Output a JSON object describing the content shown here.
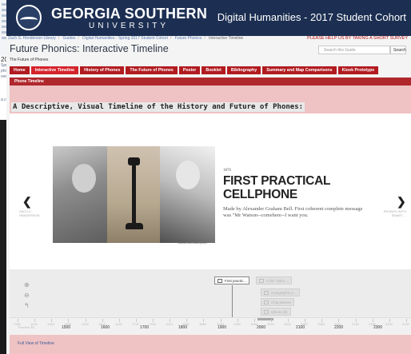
{
  "background_page": {
    "items": [
      "2017",
      "Spring",
      "phonics",
      "over",
      "a contr"
    ]
  },
  "header": {
    "university_name": "GEORGIA SOUTHERN",
    "university_sub": "UNIVERSITY",
    "site_title": "Digital Humanities - 2017 Student Cohort"
  },
  "breadcrumbs": [
    "Zach S. Henderson Library",
    "Guides",
    "Digital Humanities - Spring 2017 Student Cohort",
    "Future Phonics",
    "Interactive Timeline"
  ],
  "help_link": "PLEASE HELP US BY TAKING A SHORT SURVEY",
  "guide": {
    "title": "Future Phonics: Interactive Timeline",
    "owner": "The Future of Phones"
  },
  "search": {
    "placeholder": "Search this Guide",
    "button": "Search"
  },
  "tabs": [
    "Home",
    "Interactive Timeline",
    "History of Phones",
    "The Future of Phones",
    "Poster",
    "Booklet",
    "Bibliography",
    "Summary and Map Comparisons",
    "Kiosk Prototype"
  ],
  "active_tab": "Interactive Timeline",
  "section_title": "Phone Timeline",
  "timeline_heading": "A Descriptive, Visual Timeline of the History and Future of Phones:",
  "slide": {
    "credit": "Savannah.Bailey440",
    "year": "1876",
    "title": "FIRST PRACTICAL CELLPHONE",
    "text": "Made by Alexander Graham Bell. First coherent complete message was \"Mr Watson--comehere--I want you.",
    "prev_label": "ZACH S. HENDERSON",
    "next_label": "PHONES WITH SMART ..."
  },
  "nav_controls": {
    "zoom_in": "⊕",
    "zoom_out": "⊖",
    "back": "↰"
  },
  "markers": {
    "active": "First practic...",
    "ghosts": [
      "Color Video ...",
      "Holographic p...",
      "Chip phones",
      "Iphone (8)"
    ]
  },
  "axis": {
    "minor_labels": [
      "1380",
      "1440",
      "1460",
      "1480",
      "1540",
      "1610",
      "1640",
      "1720",
      "1760",
      "1810",
      "1850",
      "1880",
      "1940",
      "1960",
      "1980",
      "2020",
      "2000",
      "2050",
      "2080",
      "2110",
      "2150",
      "2180",
      "2200",
      "2240"
    ],
    "major_labels": [
      "1500",
      "1600",
      "1700",
      "1800",
      "1900",
      "2000",
      "2100",
      "2200",
      "2300"
    ],
    "left_corner": "Timeline 3D"
  },
  "footer_link": "Full View of Timeline",
  "colors": {
    "header_bg": "#1c2f52",
    "tab_red": "#b11b20",
    "panel_pink": "#efc2c3",
    "link_blue": "#3d5c99"
  }
}
